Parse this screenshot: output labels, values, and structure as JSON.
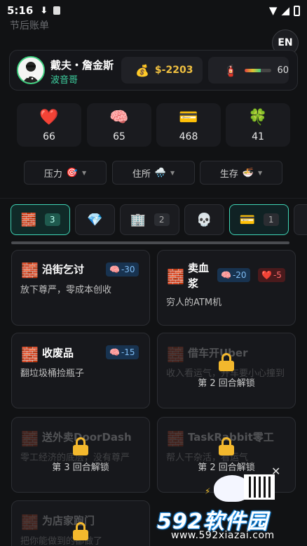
{
  "status_bar": {
    "time": "5:16",
    "download_icon": "download-icon",
    "a_icon": "a-icon"
  },
  "header": {
    "faded_title": "节后账单",
    "lang_button": "EN"
  },
  "profile": {
    "name": "戴夫・詹金斯",
    "role": "波音哥",
    "money": "$-2203",
    "health_value": "60",
    "health_fraction": 0.6
  },
  "stats": [
    {
      "icon": "❤️",
      "icon_name": "heart-icon",
      "value": "66"
    },
    {
      "icon": "🧠",
      "icon_name": "brain-icon",
      "value": "65"
    },
    {
      "icon": "💳",
      "icon_name": "card-icon",
      "value": "468"
    },
    {
      "icon": "🍀",
      "icon_name": "clover-icon",
      "value": "41"
    }
  ],
  "dropdowns": [
    {
      "label": "压力",
      "icon": "🎯"
    },
    {
      "label": "住所",
      "icon": "🌧️"
    },
    {
      "label": "生存",
      "icon": "🍜"
    }
  ],
  "tabs": [
    {
      "icon": "🧱",
      "count": "3"
    },
    {
      "icon": "💎",
      "count": ""
    },
    {
      "icon": "🏢",
      "count": "2"
    },
    {
      "icon": "💀",
      "count": ""
    },
    {
      "icon": "💳",
      "count": "1"
    }
  ],
  "cards": [
    {
      "title": "沿街乞讨",
      "desc": "放下尊严，零成本创收",
      "pill_brain": "-30"
    },
    {
      "title": "卖血浆",
      "desc": "穷人的ATM机",
      "pill_brain": "-20",
      "pill_heart": "-5"
    },
    {
      "title": "收废品",
      "desc": "翻垃圾桶捡瓶子",
      "pill_brain": "-15"
    },
    {
      "title": "借车开Uber",
      "desc": "收入看运气，开车要小心撞到",
      "lock_text": "第 2 回合解锁"
    },
    {
      "title": "送外卖DoorDash",
      "desc": "零工经济的底层，没有尊严",
      "lock_text": "第 3 回合解锁"
    },
    {
      "title": "TaskRabbit零工",
      "desc": "帮人干杂活，看运气",
      "lock_text": "第 2 回合解锁"
    },
    {
      "title": "为店家跑门",
      "desc": "把你能做到的都做了"
    }
  ],
  "watermark": {
    "logo": "592软件园",
    "url": "www.592xiazai.com"
  },
  "ad": {
    "close": "✕"
  },
  "colors": {
    "accent": "#3fd4b5",
    "money": "#f0c040",
    "lock": "#f3b82d"
  }
}
